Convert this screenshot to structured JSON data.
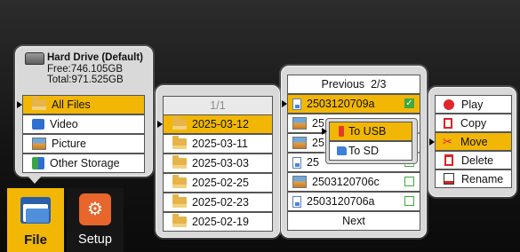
{
  "drive": {
    "name": "Hard Drive (Default)",
    "free": "Free:746.105GB",
    "total": "Total:971.525GB"
  },
  "categories": [
    {
      "label": "All Files",
      "icon": "folder-icon",
      "selected": true
    },
    {
      "label": "Video",
      "icon": "video-icon",
      "selected": false
    },
    {
      "label": "Picture",
      "icon": "picture-icon",
      "selected": false
    },
    {
      "label": "Other Storage",
      "icon": "other-storage-icon",
      "selected": false
    }
  ],
  "folders": {
    "page": "1/1",
    "items": [
      {
        "label": "2025-03-12",
        "selected": true
      },
      {
        "label": "2025-03-11",
        "selected": false
      },
      {
        "label": "2025-03-03",
        "selected": false
      },
      {
        "label": "2025-02-25",
        "selected": false
      },
      {
        "label": "2025-02-23",
        "selected": false
      },
      {
        "label": "2025-02-19",
        "selected": false
      }
    ]
  },
  "files": {
    "previous": "Previous  2/3",
    "next": "Next",
    "items": [
      {
        "label": "2503120709a",
        "type": "video",
        "checked": true,
        "selected": true
      },
      {
        "label": "25",
        "type": "picture",
        "checked": false,
        "selected": false
      },
      {
        "label": "25",
        "type": "picture",
        "checked": false,
        "selected": false
      },
      {
        "label": "25",
        "type": "video",
        "checked": false,
        "selected": false
      },
      {
        "label": "2503120706c",
        "type": "picture",
        "checked": false,
        "selected": false
      },
      {
        "label": "2503120706a",
        "type": "video",
        "checked": false,
        "selected": false
      }
    ]
  },
  "transfer_menu": {
    "items": [
      {
        "label": "To USB",
        "selected": true
      },
      {
        "label": "To SD",
        "selected": false
      }
    ]
  },
  "actions": {
    "items": [
      {
        "label": "Play",
        "icon": "play-icon",
        "selected": false
      },
      {
        "label": "Copy",
        "icon": "copy-icon",
        "selected": false
      },
      {
        "label": "Move",
        "icon": "scissors-icon",
        "selected": true
      },
      {
        "label": "Delete",
        "icon": "trash-icon",
        "selected": false
      },
      {
        "label": "Rename",
        "icon": "rename-icon",
        "selected": false
      }
    ]
  },
  "tabs": [
    {
      "label": "File",
      "active": true
    },
    {
      "label": "Setup",
      "active": false
    }
  ],
  "colors": {
    "selected": "#f2b705",
    "check": "#3fa83f",
    "setup_tile": "#e8662c",
    "file_tab": "#f2b705"
  }
}
